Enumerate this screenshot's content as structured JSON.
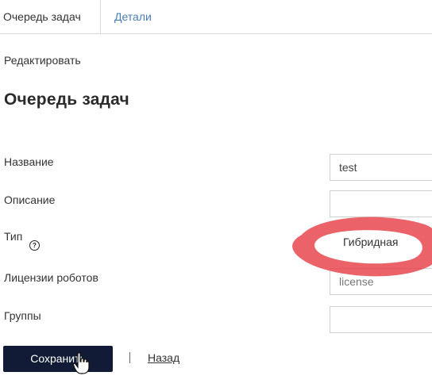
{
  "tabs": [
    {
      "label": "Очередь задач",
      "active": true
    },
    {
      "label": "Детали",
      "active": false
    }
  ],
  "edit_label": "Редактировать",
  "title": "Очередь задач",
  "fields": {
    "name": {
      "label": "Название",
      "value": "test"
    },
    "description": {
      "label": "Описание",
      "value": ""
    },
    "type": {
      "label": "Тип",
      "help": "?",
      "value": "Гибридная"
    },
    "licenses": {
      "label": "Лицензии роботов",
      "value": "license"
    },
    "groups": {
      "label": "Группы",
      "value": ""
    }
  },
  "actions": {
    "save_label": "Сохранить",
    "back_label": "Назад"
  },
  "colors": {
    "primary_button": "#111b35",
    "tab_link": "#4a7fb5",
    "annotation": "#e8474f"
  }
}
